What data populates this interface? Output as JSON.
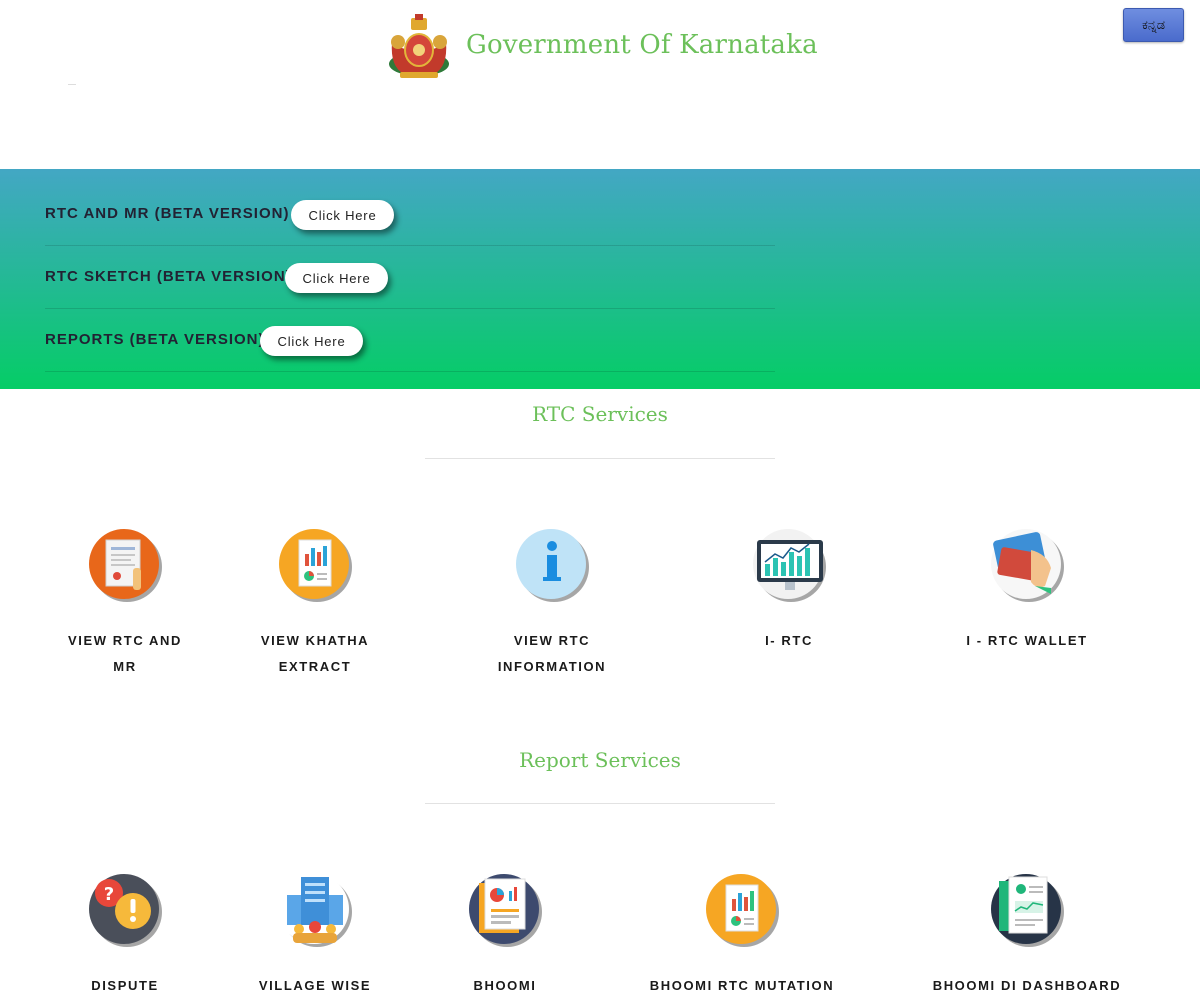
{
  "header": {
    "title": "Government Of Karnataka",
    "language_button": "ಕನ್ನಡ"
  },
  "banner": {
    "rows": [
      {
        "label": "RTC AND MR (BETA VERSION)",
        "button": "Click Here"
      },
      {
        "label": "RTC SKETCH (BETA VERSION)",
        "button": "Click Here"
      },
      {
        "label": "REPORTS (BETA VERSION)",
        "button": "Click Here"
      }
    ],
    "colors": {
      "top": "#43a7c4",
      "bottom": "#05cd66"
    }
  },
  "rtc_services": {
    "title": "RTC Services",
    "items": [
      {
        "label_line1": "VIEW RTC AND",
        "label_line2": "MR",
        "icon": "document-icon"
      },
      {
        "label_line1": "VIEW KHATHA",
        "label_line2": "EXTRACT",
        "icon": "report-chart-icon"
      },
      {
        "label_line1": "VIEW RTC",
        "label_line2": "INFORMATION",
        "icon": "info-icon"
      },
      {
        "label_line1": "I- RTC",
        "label_line2": "",
        "icon": "monitor-chart-icon"
      },
      {
        "label_line1": "I - RTC WALLET",
        "label_line2": "",
        "icon": "wallet-card-icon"
      }
    ]
  },
  "report_services": {
    "title": "Report Services",
    "items": [
      {
        "label_line1": "DISPUTE",
        "icon": "question-alert-icon"
      },
      {
        "label_line1": "VILLAGE WISE",
        "icon": "building-people-icon"
      },
      {
        "label_line1": "BHOOMI",
        "icon": "analytics-docs-icon"
      },
      {
        "label_line1": "BHOOMI RTC MUTATION",
        "icon": "report-chart-icon"
      },
      {
        "label_line1": "BHOOMI DI DASHBOARD",
        "icon": "dashboard-docs-icon"
      }
    ]
  },
  "theme": {
    "accent_green": "#6cc05a",
    "language_button_blue": "#5679d6"
  }
}
